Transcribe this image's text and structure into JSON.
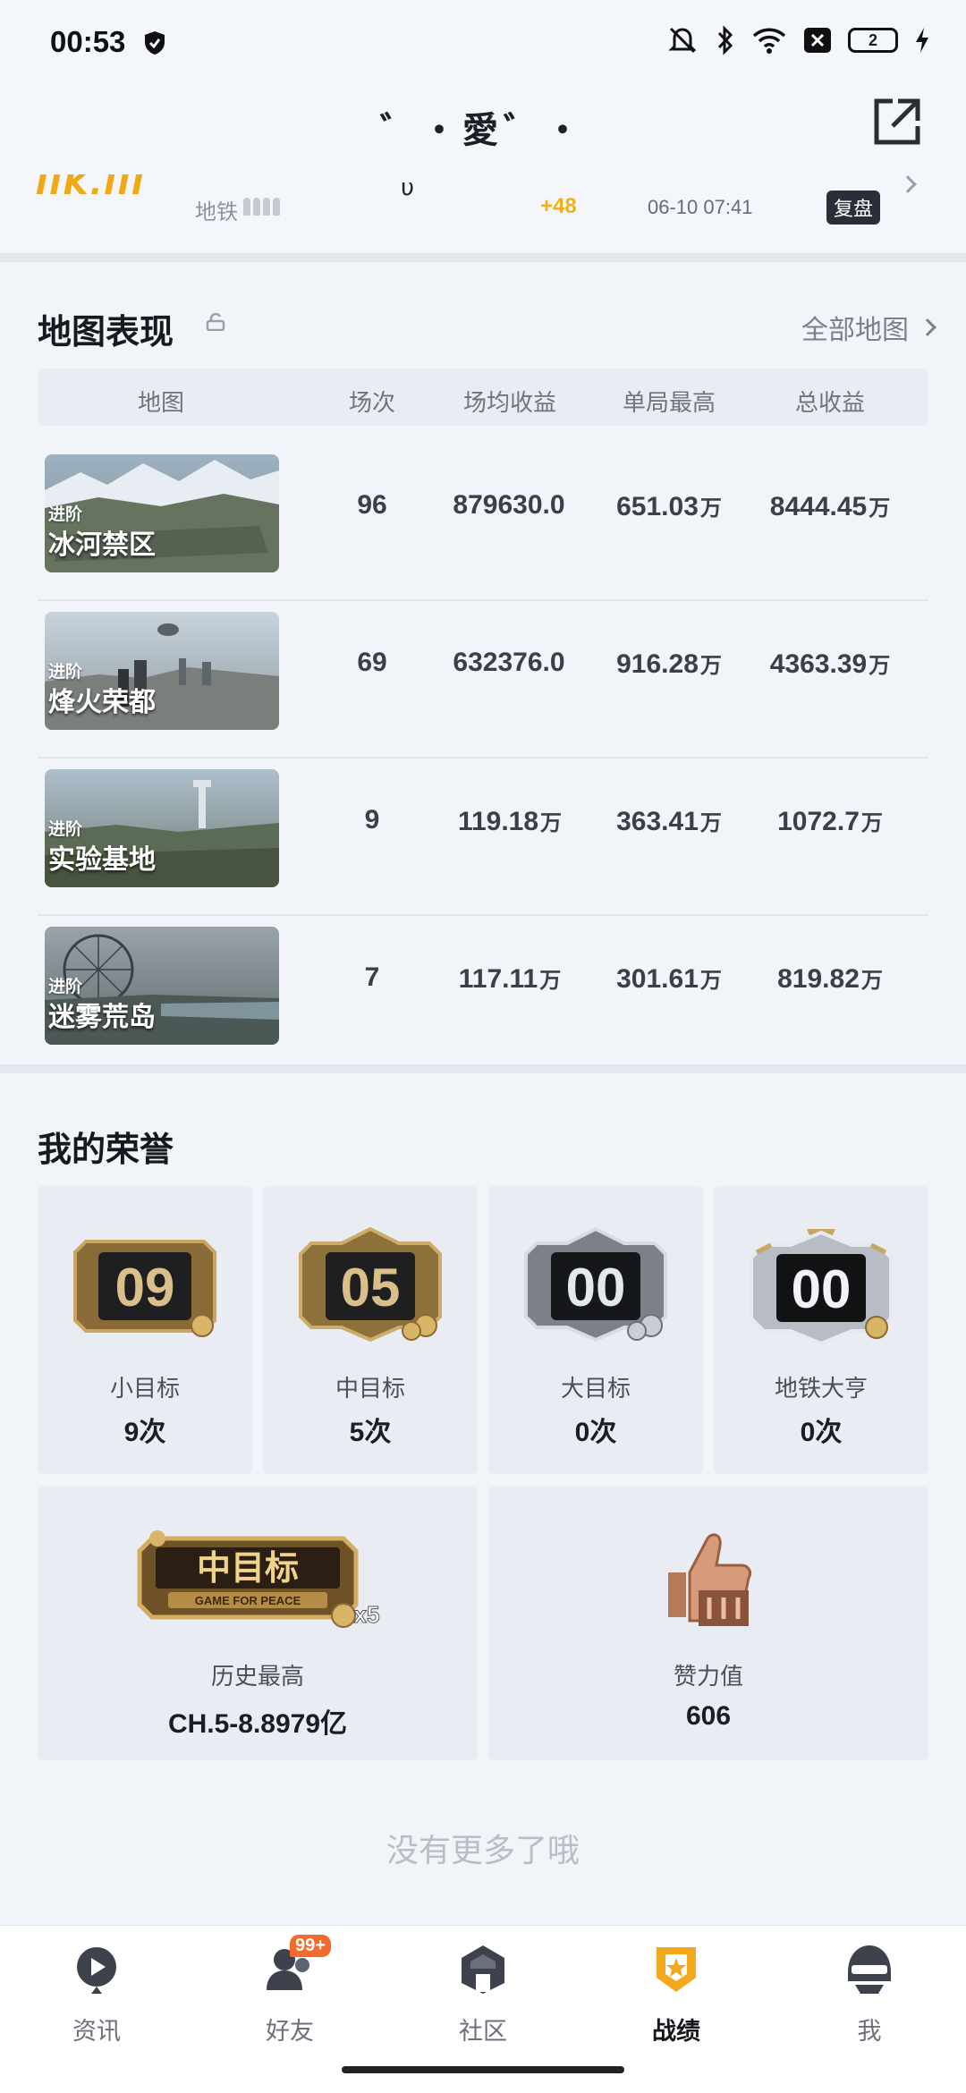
{
  "status_bar": {
    "time": "00:53",
    "battery": "2"
  },
  "header": {
    "title": "゛・愛゛・"
  },
  "partial_row": {
    "logo": "IIK.III",
    "mode": "地铁",
    "u": "υ",
    "delta": "+48",
    "datetime": "06-10 07:41",
    "review": "复盘"
  },
  "map_section": {
    "title": "地图表现",
    "all_maps": "全部地图",
    "columns": [
      "地图",
      "场次",
      "场均收益",
      "单局最高",
      "总收益"
    ],
    "rows": [
      {
        "tag": "进阶",
        "name": "冰河禁区",
        "matches": "96",
        "avg": "879630.0",
        "avg_unit": "",
        "best": "651.03",
        "best_unit": "万",
        "total": "8444.45",
        "total_unit": "万"
      },
      {
        "tag": "进阶",
        "name": "烽火荣都",
        "matches": "69",
        "avg": "632376.0",
        "avg_unit": "",
        "best": "916.28",
        "best_unit": "万",
        "total": "4363.39",
        "total_unit": "万"
      },
      {
        "tag": "进阶",
        "name": "实验基地",
        "matches": "9",
        "avg": "119.18",
        "avg_unit": "万",
        "best": "363.41",
        "best_unit": "万",
        "total": "1072.7",
        "total_unit": "万"
      },
      {
        "tag": "进阶",
        "name": "迷雾荒岛",
        "matches": "7",
        "avg": "117.11",
        "avg_unit": "万",
        "best": "301.61",
        "best_unit": "万",
        "total": "819.82",
        "total_unit": "万"
      }
    ]
  },
  "honor_section": {
    "title": "我的荣誉",
    "badges": [
      {
        "number": "09",
        "label": "小目标",
        "value": "9次"
      },
      {
        "number": "05",
        "label": "中目标",
        "value": "5次"
      },
      {
        "number": "00",
        "label": "大目标",
        "value": "0次"
      },
      {
        "number": "00",
        "label": "地铁大亨",
        "value": "0次"
      }
    ],
    "history": {
      "badge_text": "中目标",
      "badge_sub": "GAME FOR PEACE",
      "multiplier": "x5",
      "label": "历史最高",
      "value": "CH.5-8.8979亿"
    },
    "likes": {
      "label": "赞力值",
      "value": "606"
    }
  },
  "no_more": "没有更多了哦",
  "tabbar": {
    "badge": "99+",
    "tabs": [
      {
        "label": "资讯",
        "icon": "news-play-icon"
      },
      {
        "label": "好友",
        "icon": "friends-icon"
      },
      {
        "label": "社区",
        "icon": "community-icon"
      },
      {
        "label": "战绩",
        "icon": "record-shield-icon"
      },
      {
        "label": "我",
        "icon": "helmet-profile-icon"
      }
    ]
  },
  "colors": {
    "accent": "#f2b01e",
    "background": "#f1f4f9",
    "card": "#e9edf3",
    "badge": "#f26a2e"
  }
}
